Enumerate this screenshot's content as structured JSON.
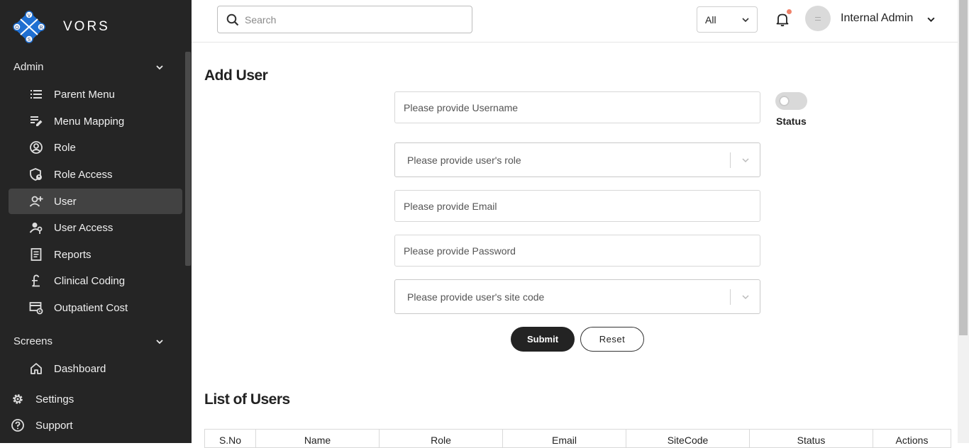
{
  "brand": {
    "name": "VORS",
    "logo_letters": [
      "V",
      "O",
      "R",
      "S"
    ]
  },
  "sidebar": {
    "admin_section": "Admin",
    "admin_items": [
      {
        "label": "Parent Menu",
        "icon": "list-icon"
      },
      {
        "label": "Menu Mapping",
        "icon": "edit-list-icon"
      },
      {
        "label": "Role",
        "icon": "user-circle-icon"
      },
      {
        "label": "Role Access",
        "icon": "shield-user-icon"
      },
      {
        "label": "User",
        "icon": "user-add-icon",
        "active": true
      },
      {
        "label": "User Access",
        "icon": "user-key-icon"
      },
      {
        "label": "Reports",
        "icon": "report-icon"
      },
      {
        "label": "Clinical Coding",
        "icon": "pound-icon"
      },
      {
        "label": "Outpatient Cost",
        "icon": "card-gear-icon"
      }
    ],
    "screens_section": "Screens",
    "screens_items": [
      {
        "label": "Dashboard",
        "icon": "home-icon"
      }
    ],
    "settings_label": "Settings",
    "support_label": "Support"
  },
  "header": {
    "search_placeholder": "Search",
    "filter_value": "All",
    "user_name": "Internal Admin"
  },
  "form": {
    "title": "Add User",
    "username_placeholder": "Please provide Username",
    "role_placeholder": "Please provide user's role",
    "email_placeholder": "Please provide Email",
    "password_placeholder": "Please provide Password",
    "sitecode_placeholder": "Please provide user's site code",
    "status_label": "Status",
    "status_on": false,
    "submit_label": "Submit",
    "reset_label": "Reset"
  },
  "users_list": {
    "title": "List of Users",
    "columns": [
      "S.No",
      "Name",
      "Role",
      "Email",
      "SiteCode",
      "Status",
      "Actions"
    ]
  },
  "colors": {
    "sidebar_bg": "#252525",
    "active_item_bg": "#424242",
    "brand_blue": "#1f6fd1",
    "notification_dot": "#f0826a",
    "submit_bg": "#232323"
  }
}
